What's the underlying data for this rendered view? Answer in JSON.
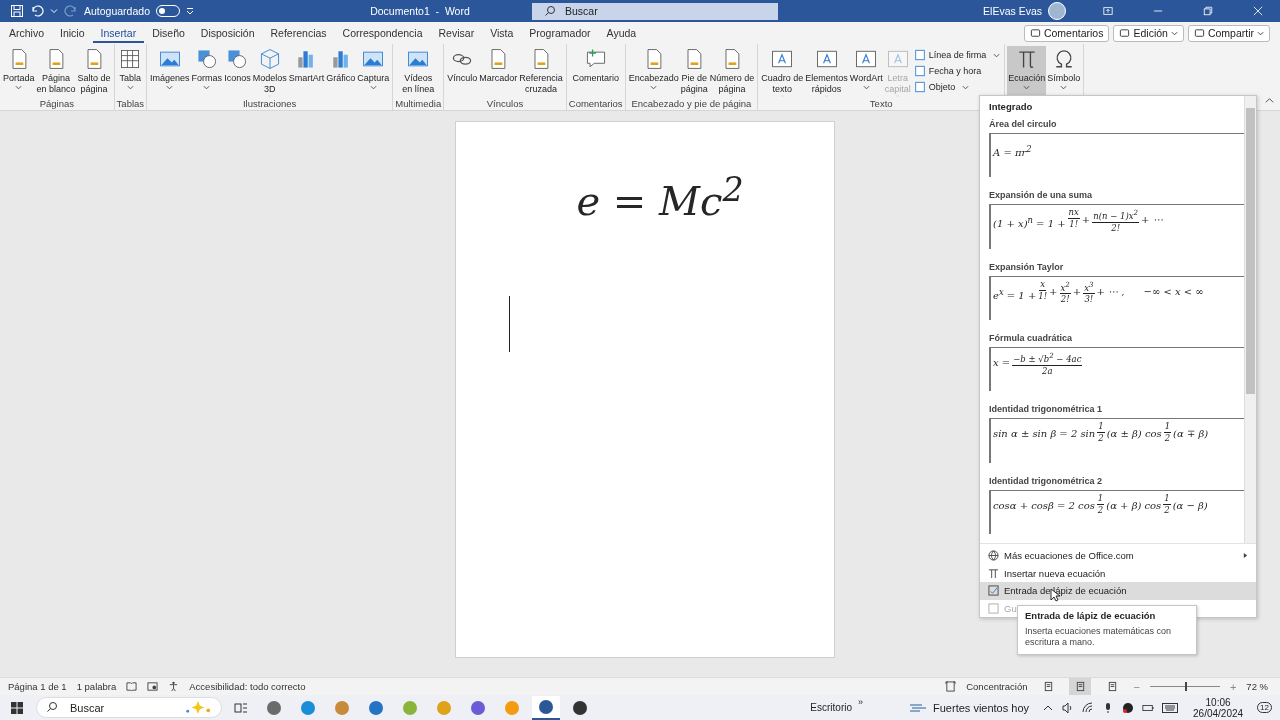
{
  "title_bar": {
    "autosave": {
      "label": "Autoguardado",
      "on": false
    },
    "title": "Documento1  -  Word",
    "search_placeholder": "Buscar",
    "user": "ElEvas Evas"
  },
  "tabs": [
    {
      "label": "Archivo",
      "selected": false
    },
    {
      "label": "Inicio",
      "selected": false
    },
    {
      "label": "Insertar",
      "selected": true
    },
    {
      "label": "Diseño",
      "selected": false
    },
    {
      "label": "Disposición",
      "selected": false
    },
    {
      "label": "Referencias",
      "selected": false
    },
    {
      "label": "Correspondencia",
      "selected": false
    },
    {
      "label": "Revisar",
      "selected": false
    },
    {
      "label": "Vista",
      "selected": false
    },
    {
      "label": "Programador",
      "selected": false
    },
    {
      "label": "Ayuda",
      "selected": false
    }
  ],
  "header_buttons": [
    {
      "label": "Comentarios",
      "caret": false
    },
    {
      "label": "Edición",
      "caret": true
    },
    {
      "label": "Compartir",
      "caret": true
    }
  ],
  "ribbon_groups": [
    {
      "label": "Páginas",
      "items": [
        {
          "kind": "large",
          "label": "Portada",
          "caret": true,
          "disabled": false,
          "pressed": false
        },
        {
          "kind": "large",
          "label": "Página\nen blanco",
          "caret": false,
          "disabled": false,
          "pressed": false
        },
        {
          "kind": "large",
          "label": "Salto de\npágina",
          "caret": false,
          "disabled": false,
          "pressed": false
        }
      ]
    },
    {
      "label": "Tablas",
      "items": [
        {
          "kind": "large",
          "label": "Tabla",
          "caret": true,
          "disabled": false,
          "pressed": false
        }
      ]
    },
    {
      "label": "Ilustraciones",
      "items": [
        {
          "kind": "large",
          "label": "Imágenes",
          "caret": true,
          "disabled": false,
          "pressed": false
        },
        {
          "kind": "large",
          "label": "Formas",
          "caret": true,
          "disabled": false,
          "pressed": false
        },
        {
          "kind": "large",
          "label": "Iconos",
          "caret": false,
          "disabled": false,
          "pressed": false
        },
        {
          "kind": "large",
          "label": "Modelos\n3D",
          "caret": true,
          "disabled": false,
          "pressed": false
        },
        {
          "kind": "large",
          "label": "SmartArt",
          "caret": false,
          "disabled": false,
          "pressed": false
        },
        {
          "kind": "large",
          "label": "Gráfico",
          "caret": false,
          "disabled": false,
          "pressed": false
        },
        {
          "kind": "large",
          "label": "Captura",
          "caret": true,
          "disabled": false,
          "pressed": false
        }
      ]
    },
    {
      "label": "Multimedia",
      "items": [
        {
          "kind": "large",
          "label": "Vídeos\nen línea",
          "caret": false,
          "disabled": false,
          "pressed": false
        }
      ]
    },
    {
      "label": "Vínculos",
      "items": [
        {
          "kind": "large",
          "label": "Vínculo",
          "caret": false,
          "disabled": false,
          "pressed": false
        },
        {
          "kind": "large",
          "label": "Marcador",
          "caret": false,
          "disabled": false,
          "pressed": false
        },
        {
          "kind": "large",
          "label": "Referencia\ncruzada",
          "caret": false,
          "disabled": false,
          "pressed": false
        }
      ]
    },
    {
      "label": "Comentarios",
      "items": [
        {
          "kind": "large",
          "label": "Comentario",
          "caret": false,
          "disabled": false,
          "pressed": false
        }
      ]
    },
    {
      "label": "Encabezado y pie de página",
      "items": [
        {
          "kind": "large",
          "label": "Encabezado",
          "caret": true,
          "disabled": false,
          "pressed": false
        },
        {
          "kind": "large",
          "label": "Pie de\npágina",
          "caret": true,
          "disabled": false,
          "pressed": false
        },
        {
          "kind": "large",
          "label": "Número de\npágina",
          "caret": true,
          "disabled": false,
          "pressed": false
        }
      ]
    },
    {
      "label": "Texto",
      "items": [
        {
          "kind": "large",
          "label": "Cuadro de\ntexto",
          "caret": true,
          "disabled": false,
          "pressed": false
        },
        {
          "kind": "large",
          "label": "Elementos\nrápidos",
          "caret": true,
          "disabled": false,
          "pressed": false
        },
        {
          "kind": "large",
          "label": "WordArt",
          "caret": true,
          "disabled": false,
          "pressed": false
        },
        {
          "kind": "large",
          "label": "Letra\ncapital",
          "caret": true,
          "disabled": true,
          "pressed": false
        },
        {
          "kind": "small",
          "label": "Línea de firma",
          "caret": true,
          "disabled": false,
          "pressed": false
        },
        {
          "kind": "small",
          "label": "Fecha y hora",
          "caret": false,
          "disabled": false,
          "pressed": false
        },
        {
          "kind": "small",
          "label": "Objeto",
          "caret": true,
          "disabled": false,
          "pressed": false
        }
      ]
    },
    {
      "items": [
        {
          "kind": "large",
          "label": "Ecuación",
          "caret": true,
          "disabled": false,
          "pressed": true
        },
        {
          "kind": "large",
          "label": "Símbolo",
          "caret": true,
          "disabled": false,
          "pressed": false
        }
      ]
    }
  ],
  "document": {
    "equation": "e = Mc$^{2}$"
  },
  "equation_menu": {
    "heading": "Integrado",
    "gallery": [
      {
        "title": "Área del circulo",
        "equation": [
          {
            "kind": "text",
            "text": "A = πr$^{2}$"
          }
        ]
      },
      {
        "title": "Expansión de una suma",
        "equation": [
          {
            "kind": "text",
            "text": "(1 + x)$^{n}$ = 1 +"
          },
          {
            "kind": "frac",
            "num": "nx",
            "den": "1!"
          },
          {
            "kind": "text",
            "text": "+"
          },
          {
            "kind": "frac",
            "num": "n(n − 1)x$^{2}$",
            "den": "2!"
          },
          {
            "kind": "text",
            "text": "+ ⋯"
          }
        ]
      },
      {
        "title": "Expansión Taylor",
        "equation": [
          {
            "kind": "text",
            "text": "e$^{x}$ = 1 +"
          },
          {
            "kind": "frac",
            "num": "x",
            "den": "1!"
          },
          {
            "kind": "text",
            "text": "+"
          },
          {
            "kind": "frac",
            "num": "x$^{2}$",
            "den": "2!"
          },
          {
            "kind": "text",
            "text": "+"
          },
          {
            "kind": "frac",
            "num": "x$^{3}$",
            "den": "3!"
          },
          {
            "kind": "text",
            "text": "+ ⋯ ,      −∞ < x < ∞"
          }
        ]
      },
      {
        "title": "Fórmula cuadrática",
        "equation": [
          {
            "kind": "text",
            "text": "x ="
          },
          {
            "kind": "frac",
            "num": "−b ± √b$^{2}$ − 4ac",
            "den": "2a"
          }
        ]
      },
      {
        "title": "Identidad trigonométrica 1",
        "equation": [
          {
            "kind": "text",
            "text": "sin α ± sin β = 2 sin"
          },
          {
            "kind": "frac",
            "num": "1",
            "den": "2"
          },
          {
            "kind": "text",
            "text": "(α ± β) cos"
          },
          {
            "kind": "frac",
            "num": "1",
            "den": "2"
          },
          {
            "kind": "text",
            "text": "(α ∓ β)"
          }
        ]
      },
      {
        "title": "Identidad trigonométrica 2",
        "equation": [
          {
            "kind": "text",
            "text": "cosα + cosβ = 2 cos"
          },
          {
            "kind": "frac",
            "num": "1",
            "den": "2"
          },
          {
            "kind": "text",
            "text": "(α + β) cos"
          },
          {
            "kind": "frac",
            "num": "1",
            "den": "2"
          },
          {
            "kind": "text",
            "text": "(α − β)"
          }
        ]
      }
    ],
    "commands": [
      {
        "kind": "globe",
        "label": "Más ecuaciones de Office.com",
        "submenu": true,
        "selected": false,
        "disabled": false
      },
      {
        "kind": "pi",
        "label": "Insertar nueva ecuación",
        "submenu": false,
        "selected": false,
        "disabled": false
      },
      {
        "kind": "pen",
        "label": "Entrada de lápiz de ecuación",
        "submenu": false,
        "selected": true,
        "disabled": false
      },
      {
        "kind": "save",
        "label": "Gu",
        "submenu": false,
        "selected": false,
        "disabled": true
      }
    ],
    "tooltip": {
      "title": "Entrada de lápiz de ecuación",
      "text": "Inserta ecuaciones matemáticas con escritura a mano."
    }
  },
  "status_bar": {
    "page": "Página 1 de 1",
    "words": "1 palabra",
    "accessibility": "Accesibilidad: todo correcto",
    "focus": "Concentración",
    "views": [
      {
        "selected": false
      },
      {
        "selected": true
      },
      {
        "selected": false
      }
    ],
    "zoom": {
      "out": "−",
      "in": "+",
      "level": 0.5,
      "reading": "72 %"
    }
  },
  "taskbar": {
    "search_placeholder": "Buscar",
    "apps": [
      {
        "active": false
      },
      {
        "active": false
      },
      {
        "active": false
      },
      {
        "active": false
      },
      {
        "active": false
      },
      {
        "active": false
      },
      {
        "active": false
      },
      {
        "active": false
      },
      {
        "active": true
      },
      {
        "active": false
      }
    ],
    "desktop": "Escritorio",
    "more": "»",
    "weather": "Fuertes vientos hoy",
    "time": "10:06",
    "date": "26/04/2024",
    "notifications": "12"
  }
}
